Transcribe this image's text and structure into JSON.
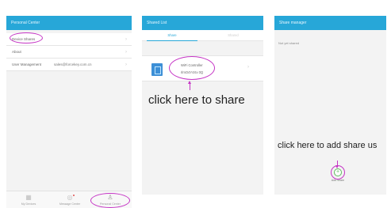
{
  "panel1": {
    "title": "Personal Center",
    "menu": [
      {
        "label": "Device Shares",
        "value": ""
      },
      {
        "label": "About",
        "value": ""
      },
      {
        "label": "User Management",
        "value": "sales@forcekey.com.cn"
      }
    ],
    "bottom_nav": [
      {
        "label": "My Devices",
        "icon": "grid-icon"
      },
      {
        "label": "Message Center",
        "icon": "message-icon"
      },
      {
        "label": "Personal Center",
        "icon": "person-icon"
      }
    ],
    "highlight_color": "#c535c5",
    "accent_color": "#27a7d8"
  },
  "panel2": {
    "title": "Shared List",
    "tabs": [
      {
        "label": "Share"
      },
      {
        "label": "Shared"
      }
    ],
    "device": {
      "name": "WiFi Controller",
      "code": "rlmO4Y4Xx 0Q"
    },
    "caption": "click here to share"
  },
  "panel3": {
    "title": "Share manager",
    "status": "Not yet shared",
    "caption": "click here to add share us",
    "add_button": {
      "label": "Add share",
      "symbol": "+"
    }
  }
}
